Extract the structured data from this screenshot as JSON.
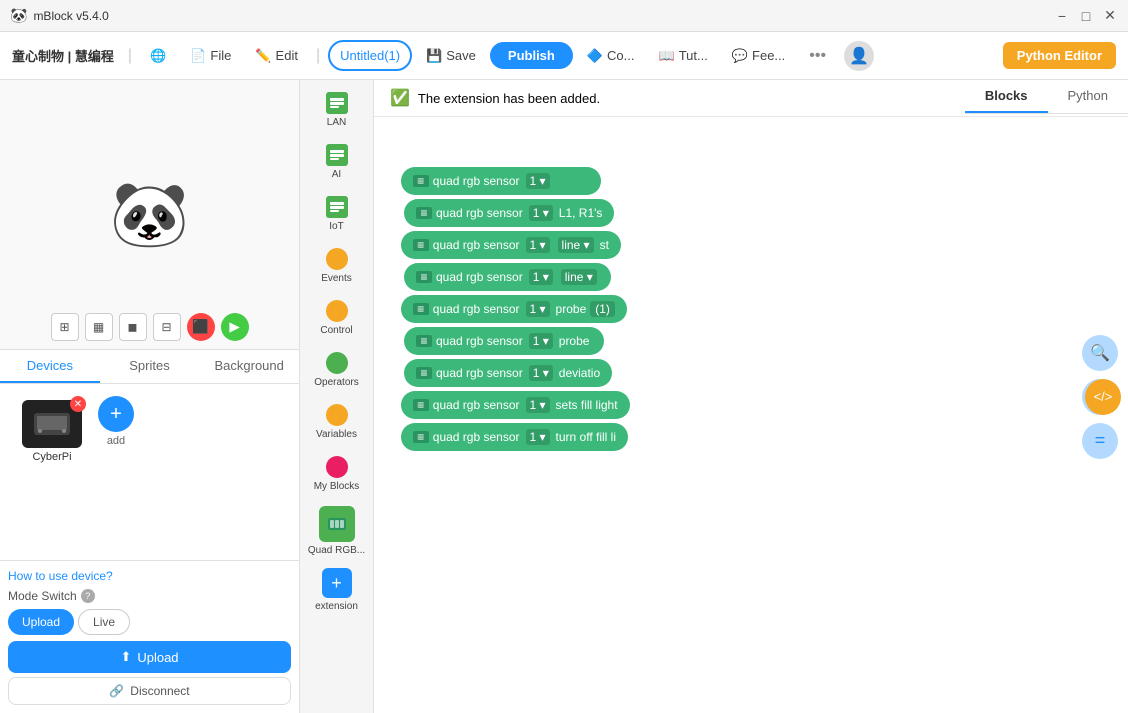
{
  "app": {
    "title": "mBlock v5.4.0",
    "logo": "🐼"
  },
  "titlebar": {
    "title": "mBlock v5.4.0",
    "minimize_label": "−",
    "maximize_label": "□",
    "close_label": "✕"
  },
  "menubar": {
    "brand": "童心制物 | 慧编程",
    "globe_icon": "🌐",
    "file_label": "File",
    "edit_label": "Edit",
    "untitled_label": "Untitled(1)",
    "save_label": "Save",
    "publish_label": "Publish",
    "co_label": "Co...",
    "tutorial_label": "Tut...",
    "feedback_label": "Fee...",
    "more_label": "•••",
    "python_editor_label": "Python Editor"
  },
  "notification": {
    "icon": "✓",
    "message": "The extension has been added."
  },
  "blocks_tabs": {
    "blocks_label": "Blocks",
    "python_label": "Python"
  },
  "categories": [
    {
      "id": "lan",
      "label": "LAN",
      "color": "#4CAF50",
      "type": "rect"
    },
    {
      "id": "ai",
      "label": "AI",
      "color": "#4CAF50",
      "type": "rect"
    },
    {
      "id": "iot",
      "label": "IoT",
      "color": "#4CAF50",
      "type": "rect"
    },
    {
      "id": "events",
      "label": "Events",
      "color": "#f5a623",
      "type": "dot"
    },
    {
      "id": "control",
      "label": "Control",
      "color": "#f5a623",
      "type": "dot"
    },
    {
      "id": "operators",
      "label": "Operators",
      "color": "#4CAF50",
      "type": "dot"
    },
    {
      "id": "variables",
      "label": "Variables",
      "color": "#f5a623",
      "type": "dot"
    },
    {
      "id": "myblocks",
      "label": "My Blocks",
      "color": "#e91e63",
      "type": "dot"
    },
    {
      "id": "quadrgb",
      "label": "Quad RGB...",
      "color": "#4CAF50",
      "type": "special"
    },
    {
      "id": "extension",
      "label": "extension",
      "color": "#1e90ff",
      "type": "plus"
    }
  ],
  "blocks": [
    {
      "id": "b1",
      "text": "quad rgb sensor  1 ▾",
      "indent": false,
      "has_arrow": true,
      "suffix": ""
    },
    {
      "id": "b2",
      "text": "quad rgb sensor  1 ▾  L1, R1's",
      "indent": true,
      "has_arrow": false
    },
    {
      "id": "b3",
      "text": "quad rgb sensor  1 ▾  line ▾  st",
      "indent": false,
      "has_arrow": true
    },
    {
      "id": "b4",
      "text": "quad rgb sensor  1 ▾  line ▾",
      "indent": true,
      "has_arrow": false
    },
    {
      "id": "b5",
      "text": "quad rgb sensor  1 ▾  probe   (1)",
      "indent": false,
      "has_arrow": true
    },
    {
      "id": "b6",
      "text": "quad rgb sensor  1 ▾  probe",
      "indent": true,
      "has_arrow": false
    },
    {
      "id": "b7",
      "text": "quad rgb sensor  1 ▾  deviatio",
      "indent": true,
      "has_arrow": false
    },
    {
      "id": "b8",
      "text": "quad rgb sensor  1 ▾  sets fill light",
      "indent": false,
      "has_arrow": false
    },
    {
      "id": "b9",
      "text": "quad rgb sensor  1 ▾  turn off fill li",
      "indent": false,
      "has_arrow": false
    }
  ],
  "sprite_tabs": [
    {
      "id": "devices",
      "label": "Devices"
    },
    {
      "id": "sprites",
      "label": "Sprites"
    },
    {
      "id": "background",
      "label": "Background"
    }
  ],
  "stage": {
    "panda_emoji": "🐼"
  },
  "device": {
    "name": "CyberPi",
    "upload_link": "How to use device?",
    "mode_switch_label": "Mode Switch",
    "upload_mode": "Upload",
    "live_mode": "Live",
    "upload_btn": "Upload",
    "disconnect_btn": "Disconnect",
    "add_label": "add"
  },
  "right_btns": {
    "zoom_in": "+",
    "zoom_out": "−",
    "fit": "="
  }
}
